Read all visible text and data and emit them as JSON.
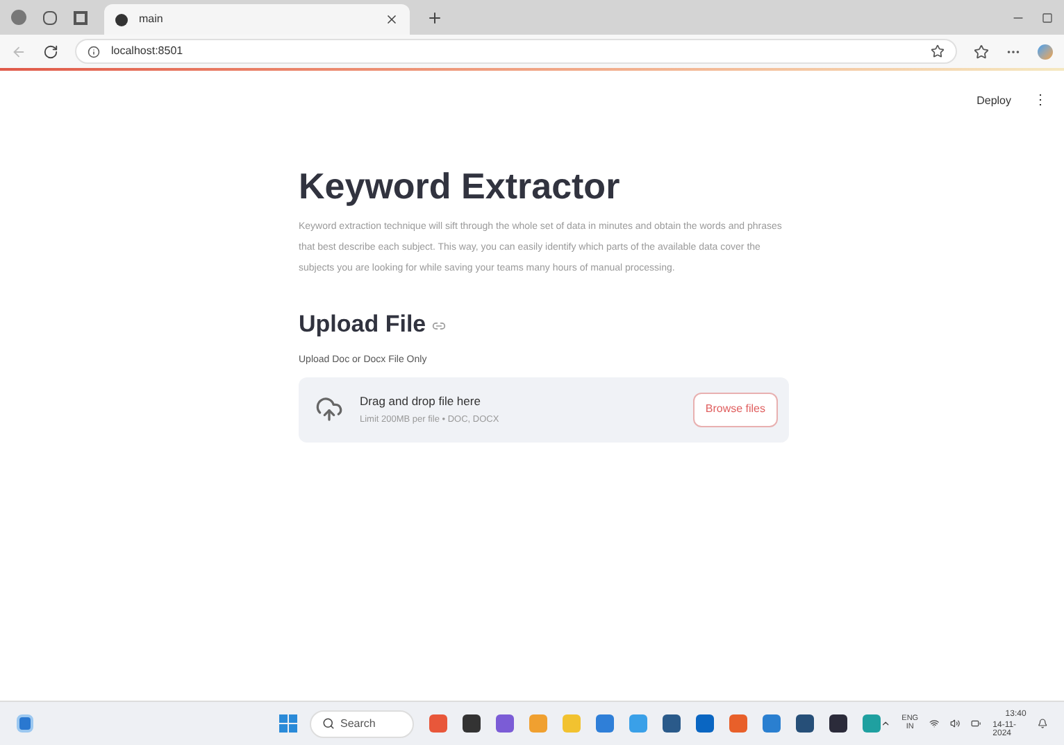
{
  "browser": {
    "tab": {
      "title": "main"
    },
    "address": "localhost:8501"
  },
  "header": {
    "deploy": "Deploy",
    "menu": "⋮"
  },
  "title": "Keyword Extractor",
  "description": "Keyword extraction technique will sift through the whole set of data in minutes and obtain the words and phrases that best describe each subject. This way, you can easily identify which parts of the available data cover the subjects you are looking for while saving your teams many hours of manual processing.",
  "upload": {
    "heading": "Upload File",
    "label": "Upload Doc or Docx File Only",
    "drop_text": "Drag and drop file here",
    "limit": "Limit 200MB per file • DOC, DOCX",
    "button": "Browse files"
  },
  "taskbar": {
    "search": "Search",
    "lang": "ENG",
    "region": "IN",
    "time": "13:40",
    "date": "14-11-2024",
    "apps": [
      {
        "color": "#e8573a"
      },
      {
        "color": "#333333"
      },
      {
        "color": "#7b5cd6"
      },
      {
        "color": "#f0a030"
      },
      {
        "color": "#f2c230"
      },
      {
        "color": "#2f7fd8"
      },
      {
        "color": "#3aa0e8"
      },
      {
        "color": "#2a5a8a"
      },
      {
        "color": "#0a66c2"
      },
      {
        "color": "#e8602a"
      },
      {
        "color": "#2a7fd0"
      },
      {
        "color": "#264f78"
      },
      {
        "color": "#2b2b3a"
      },
      {
        "color": "#1fa0a0"
      }
    ]
  }
}
